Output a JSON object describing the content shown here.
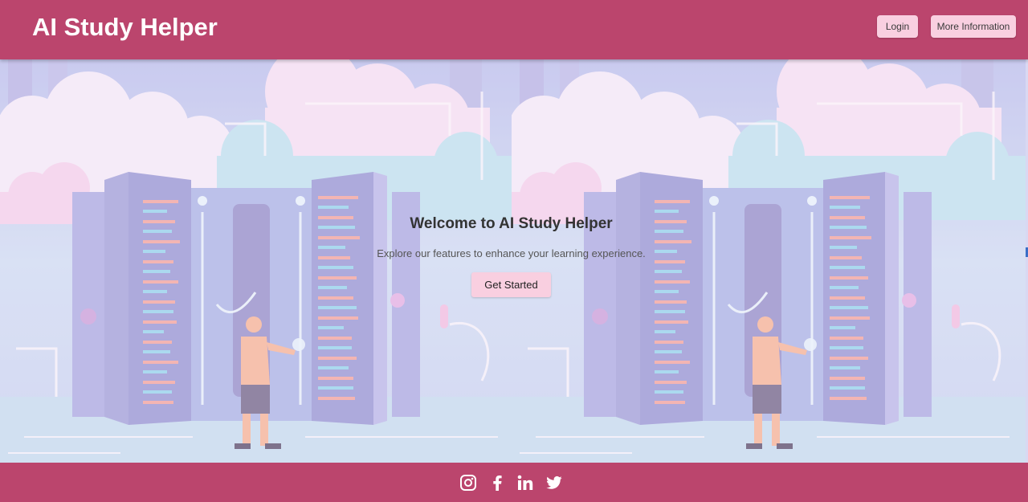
{
  "header": {
    "brand": "AI Study Helper",
    "login_label": "Login",
    "more_info_label": "More Information"
  },
  "hero": {
    "title": "Welcome to AI Study Helper",
    "subtitle": "Explore our features to enhance your learning experience.",
    "cta_label": "Get Started",
    "background_illustration": "person-at-server-racks-clouds"
  },
  "footer": {
    "icons": [
      "instagram-icon",
      "facebook-icon",
      "linkedin-icon",
      "twitter-icon"
    ]
  },
  "colors": {
    "brand": "#bb456d",
    "button": "#f9cfe0",
    "hero_tint": "#cfd7f3"
  }
}
